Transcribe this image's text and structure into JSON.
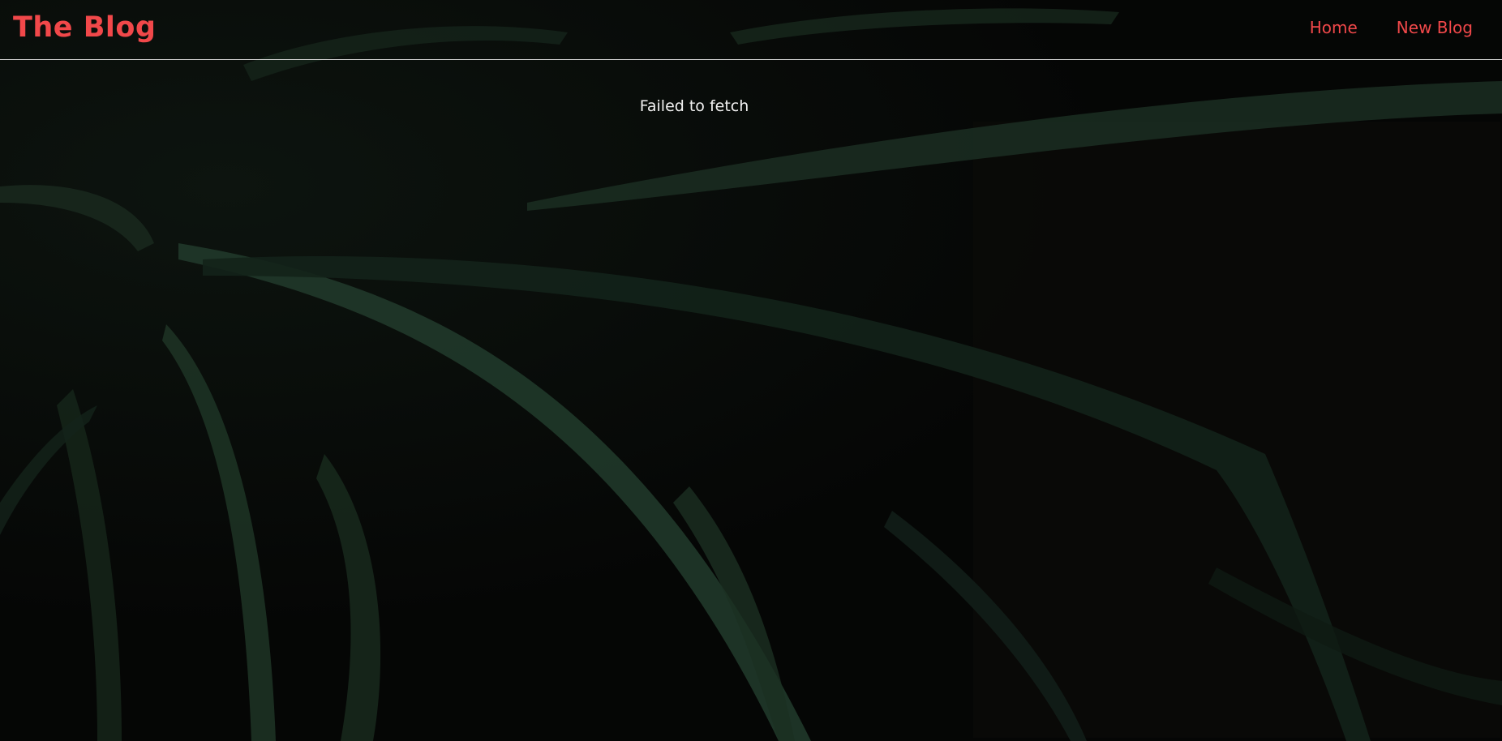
{
  "navbar": {
    "brand": "The Blog",
    "links": [
      {
        "label": "Home"
      },
      {
        "label": "New Blog"
      }
    ]
  },
  "main": {
    "error_message": "Failed to fetch"
  },
  "colors": {
    "accent": "#f1484a",
    "text": "#f2f2f2",
    "background": "#050605",
    "divider": "#d8d8d8"
  }
}
